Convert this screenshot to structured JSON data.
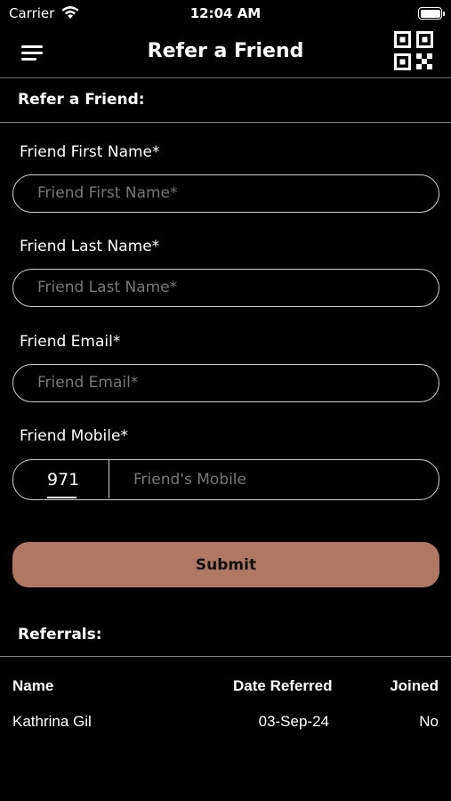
{
  "status_bar": {
    "carrier": "Carrier",
    "time": "12:04 AM"
  },
  "header": {
    "title": "Refer a Friend",
    "menu_icon": "hamburger-menu-icon",
    "qr_icon": "qr-code-icon"
  },
  "form": {
    "section_title": "Refer a Friend:",
    "first_name": {
      "label": "Friend First Name*",
      "placeholder": "Friend First Name*",
      "value": ""
    },
    "last_name": {
      "label": "Friend Last Name*",
      "placeholder": "Friend Last Name*",
      "value": ""
    },
    "email": {
      "label": "Friend Email*",
      "placeholder": "Friend Email*",
      "value": ""
    },
    "mobile": {
      "label": "Friend Mobile*",
      "country_code": "971",
      "placeholder": "Friend's Mobile",
      "value": ""
    },
    "submit_label": "Submit",
    "submit_color": "#b07763"
  },
  "referrals": {
    "section_title": "Referrals:",
    "columns": [
      "Name",
      "Date Referred",
      "Joined"
    ],
    "rows": [
      {
        "name": "Kathrina Gil",
        "date": "03-Sep-24",
        "joined": "No"
      }
    ]
  }
}
